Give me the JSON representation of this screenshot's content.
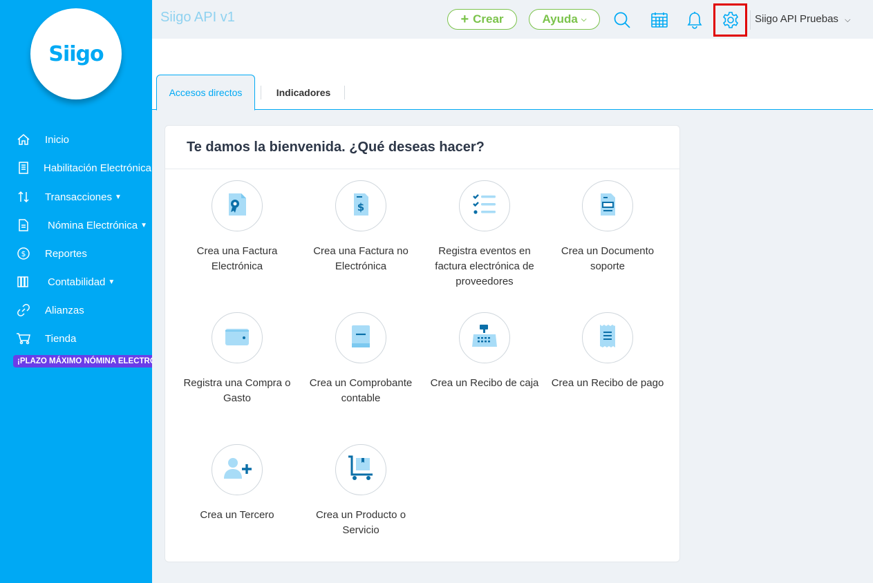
{
  "sidebar": {
    "logo": "Siigo",
    "items": [
      {
        "label": "Inicio",
        "icon": "home-icon",
        "chevron": false
      },
      {
        "label": "Habilitación Electrónica",
        "icon": "receipt-icon",
        "chevron": false
      },
      {
        "label": "Transacciones",
        "icon": "exchange-icon",
        "chevron": true
      },
      {
        "label": "Nómina Electrónica",
        "icon": "document-icon",
        "chevron": true
      },
      {
        "label": "Reportes",
        "icon": "dollar-coin-icon",
        "chevron": false
      },
      {
        "label": "Contabilidad",
        "icon": "books-icon",
        "chevron": true
      },
      {
        "label": "Alianzas",
        "icon": "link-icon",
        "chevron": false
      },
      {
        "label": "Tienda",
        "icon": "cart-icon",
        "chevron": false
      }
    ],
    "badge": "¡PLAZO MÁXIMO NÓMINA ELECTRÓNICA!"
  },
  "header": {
    "title": "Siigo API v1",
    "crear": "Crear",
    "ayuda": "Ayuda",
    "user": "Siigo API Pruebas"
  },
  "tabs": [
    {
      "label": "Accesos directos",
      "active": true
    },
    {
      "label": "Indicadores",
      "active": false
    }
  ],
  "card": {
    "title": "Te damos la bienvenida. ¿Qué deseas hacer?",
    "actions": [
      {
        "label": "Crea una Factura Electrónica",
        "icon": "electronic-invoice-icon"
      },
      {
        "label": "Crea una Factura no Electrónica",
        "icon": "invoice-dollar-icon"
      },
      {
        "label": "Registra eventos en factura electrónica de proveedores",
        "icon": "checklist-icon"
      },
      {
        "label": "Crea un Documento soporte",
        "icon": "support-document-icon"
      },
      {
        "label": "Registra una Compra o Gasto",
        "icon": "wallet-icon"
      },
      {
        "label": "Crea un Comprobante contable",
        "icon": "ledger-book-icon"
      },
      {
        "label": "Crea un Recibo de caja",
        "icon": "cash-register-icon"
      },
      {
        "label": "Crea un Recibo de pago",
        "icon": "payment-receipt-icon"
      },
      {
        "label": "Crea un Tercero",
        "icon": "add-user-icon"
      },
      {
        "label": "Crea un Producto o Servicio",
        "icon": "product-cart-icon"
      }
    ]
  },
  "colors": {
    "sidebar": "#00a9f4",
    "accent": "#00a9f4",
    "success": "#7bc34b",
    "badge": "#6a3de8",
    "highlight": "#e00000"
  }
}
